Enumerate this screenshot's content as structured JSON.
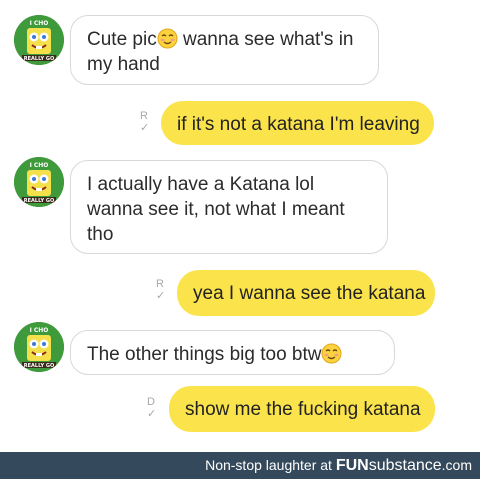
{
  "messages": [
    {
      "side": "in",
      "parts": [
        "Cute pic",
        " wanna see what's in my hand"
      ],
      "emoji": "smiling-blush-emoji"
    },
    {
      "side": "out",
      "text": "if it's not a katana I'm leaving",
      "receipt": "R"
    },
    {
      "side": "in",
      "text": "I actually have a Katana lol wanna see it, not what I meant tho"
    },
    {
      "side": "out",
      "text": "yea I wanna see the katana",
      "receipt": "R"
    },
    {
      "side": "in",
      "text": "The other things big too btw",
      "emoji": "smiling-blush-emoji"
    },
    {
      "side": "out",
      "text": "show me the fucking katana",
      "receipt": "D"
    }
  ],
  "avatar": {
    "top_text": "I CHO",
    "bottom_text": "REALLY GO"
  },
  "footer": {
    "caption": "Non-stop laughter at",
    "brand_bold": "FUN",
    "brand_light": "substance",
    "brand_suffix": ".com"
  },
  "colors": {
    "outgoing_bubble": "#fbe34b",
    "incoming_border": "#d8d8d8",
    "footer_bg": "#34495b"
  }
}
